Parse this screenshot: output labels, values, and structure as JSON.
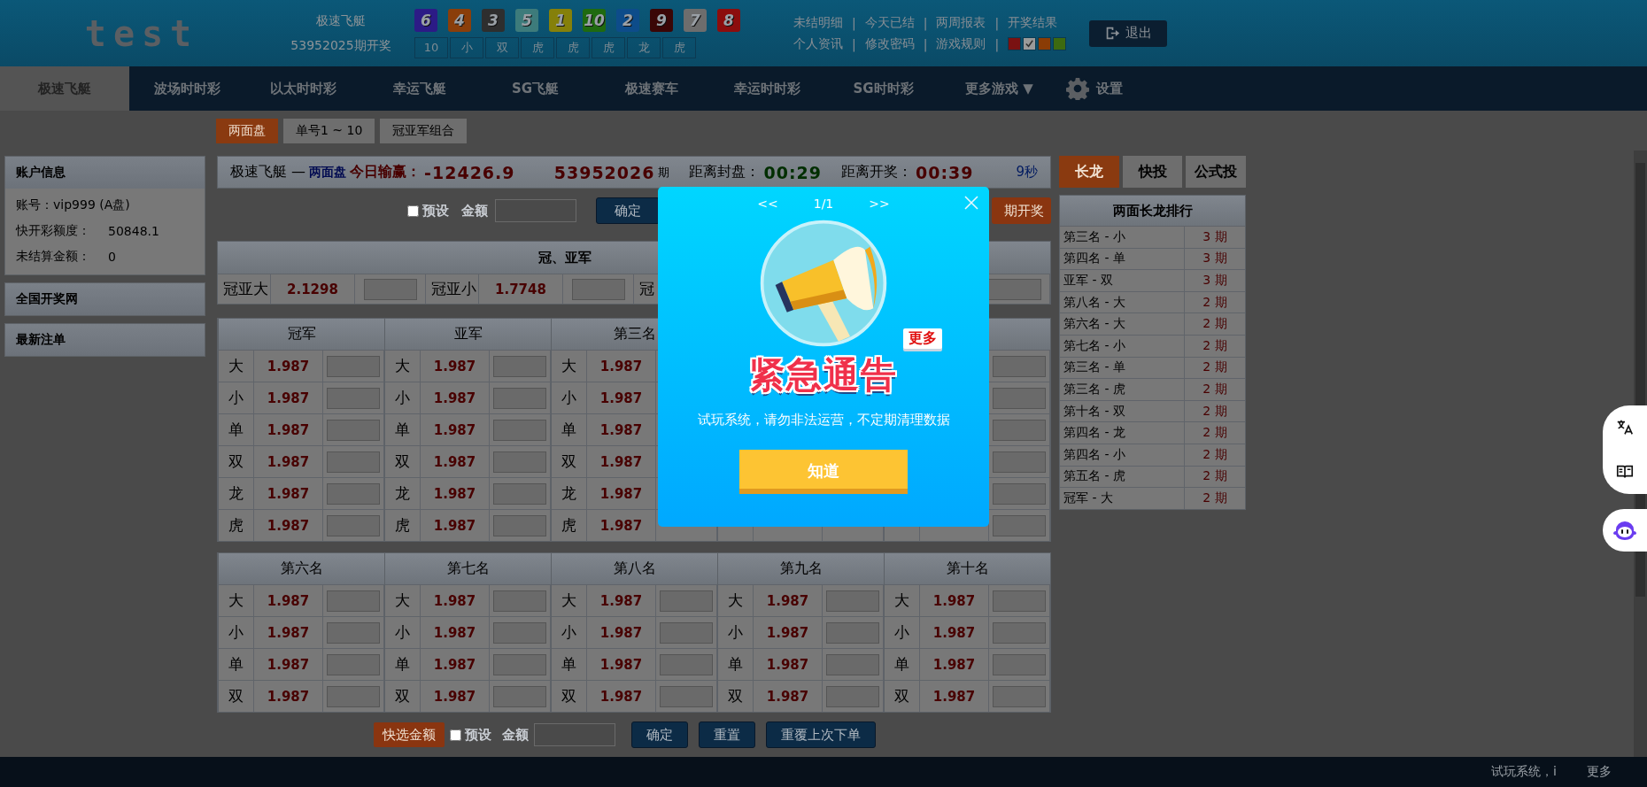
{
  "header": {
    "logo": "test",
    "game": "极速飞艇",
    "draw_label": "53952025期开奖",
    "balls": [
      {
        "number": "6",
        "color": "#2c1b86"
      },
      {
        "number": "4",
        "color": "#8a3e0a"
      },
      {
        "number": "3",
        "color": "#2e2e2e"
      },
      {
        "number": "5",
        "color": "#3d7b7b"
      },
      {
        "number": "1",
        "color": "#85800a"
      },
      {
        "number": "10",
        "color": "#1f6a10"
      },
      {
        "number": "2",
        "color": "#0d4c8a"
      },
      {
        "number": "9",
        "color": "#3a0606"
      },
      {
        "number": "7",
        "color": "#6d6d6d"
      },
      {
        "number": "8",
        "color": "#8c0d0d"
      }
    ],
    "results": [
      "10",
      "小",
      "双",
      "虎",
      "虎",
      "虎",
      "龙",
      "虎"
    ],
    "links_row1": [
      "未结明细",
      "今天已结",
      "两周报表",
      "开奖结果"
    ],
    "links_row2": [
      "个人资讯",
      "修改密码",
      "游戏规则"
    ],
    "separator": "|",
    "skins": [
      {
        "color": "#7a1212",
        "selected": false
      },
      {
        "color": "#9a9a9a",
        "selected": true
      },
      {
        "color": "#8a3c05",
        "selected": false
      },
      {
        "color": "#3d6a10",
        "selected": false
      }
    ],
    "logout": "退出"
  },
  "nav": {
    "tabs": [
      {
        "label": "极速飞艇",
        "selected": true
      },
      {
        "label": "波场时时彩",
        "selected": false
      },
      {
        "label": "以太时时彩",
        "selected": false
      },
      {
        "label": "幸运飞艇",
        "selected": false
      },
      {
        "label": "SG飞艇",
        "selected": false
      },
      {
        "label": "极速赛车",
        "selected": false
      },
      {
        "label": "幸运时时彩",
        "selected": false
      },
      {
        "label": "SG时时彩",
        "selected": false
      },
      {
        "label": "更多游戏 ▼",
        "selected": false
      }
    ],
    "settings": "设置"
  },
  "subtabs": [
    {
      "label": "两面盘",
      "selected": true
    },
    {
      "label": "单号1 ~ 10",
      "selected": false
    },
    {
      "label": "冠亚军组合",
      "selected": false
    }
  ],
  "sidebar": [
    {
      "title": "账户信息",
      "lines": [
        {
          "label": "账号：vip999 (A盘)"
        },
        {
          "label": "快开彩额度：",
          "value": "50848.1"
        },
        {
          "label": "未结算金额：",
          "value": "0"
        }
      ]
    },
    {
      "title": "全国开奖网"
    },
    {
      "title": "最新注单"
    }
  ],
  "main": {
    "title": "极速飞艇 —",
    "mode": "两面盘",
    "profit_label": "今日输赢：",
    "profit": "-12426.9",
    "period": "53952026",
    "period_suffix": "期",
    "close_label": "距离封盘：",
    "close_time": "00:29",
    "open_label": "距离开奖：",
    "open_time": "00:39",
    "refresh": "9秒",
    "bet_bar": {
      "preset": {
        "label": "预设",
        "checked": false
      },
      "amount_label": "金额",
      "confirm": "确定",
      "recent": "期开奖"
    },
    "sum_section": {
      "title": "冠、亚军",
      "items": [
        {
          "label": "冠亚大",
          "odds": "2.1298"
        },
        {
          "label": "冠亚小",
          "odds": "1.7748"
        },
        {
          "label": "冠"
        }
      ]
    },
    "grid_top": [
      {
        "title": "冠军",
        "rows": [
          {
            "label": "大",
            "odds": "1.987"
          },
          {
            "label": "小",
            "odds": "1.987"
          },
          {
            "label": "单",
            "odds": "1.987"
          },
          {
            "label": "双",
            "odds": "1.987"
          },
          {
            "label": "龙",
            "odds": "1.987"
          },
          {
            "label": "虎",
            "odds": "1.987"
          }
        ]
      },
      {
        "title": "亚军",
        "rows": [
          {
            "label": "大",
            "odds": "1.987"
          },
          {
            "label": "小",
            "odds": "1.987"
          },
          {
            "label": "单",
            "odds": "1.987"
          },
          {
            "label": "双",
            "odds": "1.987"
          },
          {
            "label": "龙",
            "odds": "1.987"
          },
          {
            "label": "虎",
            "odds": "1.987"
          }
        ]
      },
      {
        "title": "第三名",
        "rows": [
          {
            "label": "大",
            "odds": "1.987"
          },
          {
            "label": "小",
            "odds": "1.987"
          },
          {
            "label": "单",
            "odds": "1.987"
          },
          {
            "label": "双",
            "odds": "1.987"
          },
          {
            "label": "龙",
            "odds": "1.987"
          },
          {
            "label": "虎",
            "odds": "1.987"
          }
        ]
      }
    ],
    "grid_bottom": [
      {
        "title": "第六名",
        "rows": [
          {
            "label": "大",
            "odds": "1.987"
          },
          {
            "label": "小",
            "odds": "1.987"
          },
          {
            "label": "单",
            "odds": "1.987"
          },
          {
            "label": "双",
            "odds": "1.987"
          }
        ]
      },
      {
        "title": "第七名",
        "rows": [
          {
            "label": "大",
            "odds": "1.987"
          },
          {
            "label": "小",
            "odds": "1.987"
          },
          {
            "label": "单",
            "odds": "1.987"
          },
          {
            "label": "双",
            "odds": "1.987"
          }
        ]
      },
      {
        "title": "第八名",
        "rows": [
          {
            "label": "大",
            "odds": "1.987"
          },
          {
            "label": "小",
            "odds": "1.987"
          },
          {
            "label": "单",
            "odds": "1.987"
          },
          {
            "label": "双",
            "odds": "1.987"
          }
        ]
      },
      {
        "title": "第九名",
        "rows": [
          {
            "label": "大",
            "odds": "1.987"
          },
          {
            "label": "小",
            "odds": "1.987"
          },
          {
            "label": "单",
            "odds": "1.987"
          },
          {
            "label": "双",
            "odds": "1.987"
          }
        ]
      },
      {
        "title": "第十名",
        "rows": [
          {
            "label": "大",
            "odds": "1.987"
          },
          {
            "label": "小",
            "odds": "1.987"
          },
          {
            "label": "单",
            "odds": "1.987"
          },
          {
            "label": "双",
            "odds": "1.987"
          }
        ]
      }
    ],
    "footer_bar": {
      "quick": "快选金额",
      "preset": {
        "label": "预设",
        "checked": false
      },
      "amount_label": "金额",
      "buttons": [
        "确定",
        "重置",
        "重覆上次下单"
      ]
    }
  },
  "right_panel": {
    "tabs": [
      {
        "label": "长龙",
        "selected": true
      },
      {
        "label": "快投",
        "selected": false
      },
      {
        "label": "公式投",
        "selected": false
      }
    ],
    "title": "两面长龙排行",
    "rows": [
      {
        "name": "第三名 - 小",
        "count": "3 期"
      },
      {
        "name": "第四名 - 单",
        "count": "3 期"
      },
      {
        "name": "亚军 - 双",
        "count": "3 期"
      },
      {
        "name": "第八名 - 大",
        "count": "2 期"
      },
      {
        "name": "第六名 - 大",
        "count": "2 期"
      },
      {
        "name": "第七名 - 小",
        "count": "2 期"
      },
      {
        "name": "第三名 - 单",
        "count": "2 期"
      },
      {
        "name": "第三名 - 虎",
        "count": "2 期"
      },
      {
        "name": "第十名 - 双",
        "count": "2 期"
      },
      {
        "name": "第四名 - 龙",
        "count": "2 期"
      },
      {
        "name": "第四名 - 小",
        "count": "2 期"
      },
      {
        "name": "第五名 - 虎",
        "count": "2 期"
      },
      {
        "name": "冠军 - 大",
        "count": "2 期"
      }
    ]
  },
  "modal": {
    "prev": "<<",
    "page": "1/1",
    "next": ">>",
    "badge": "更多",
    "headline": "紧急通告",
    "message": "试玩系统，请勿非法运营，不定期清理数据",
    "button": "知道"
  },
  "status_bar": {
    "marquee": "试玩系统，i",
    "more": "更多"
  }
}
